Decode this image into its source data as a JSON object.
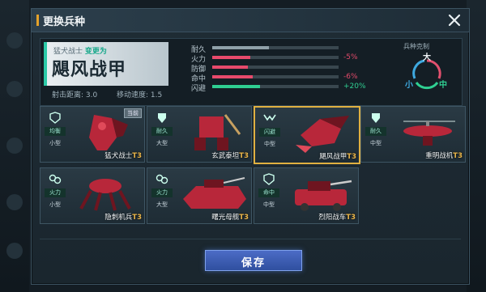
{
  "title": "更换兵种",
  "current_unit": {
    "subtitle_prefix": "猛犬战士",
    "subtitle_change": "变更为",
    "name": "飓风战甲",
    "range_label": "射击距离: 3.0",
    "speed_label": "移动速度: 1.5"
  },
  "stats": [
    {
      "label": "耐久",
      "value": 0.45,
      "color": "#8fa0a8",
      "delta": "",
      "delta_color": "#e24a6a"
    },
    {
      "label": "火力",
      "value": 0.3,
      "color": "#e84a6c",
      "delta": "-5%",
      "delta_color": "#e24a6a"
    },
    {
      "label": "防御",
      "value": 0.28,
      "color": "#e84a6c",
      "delta": "",
      "delta_color": "#e24a6a"
    },
    {
      "label": "命中",
      "value": 0.32,
      "color": "#e84a6c",
      "delta": "-6%",
      "delta_color": "#e24a6a"
    },
    {
      "label": "闪避",
      "value": 0.38,
      "color": "#2fcf92",
      "delta": "+20%",
      "delta_color": "#2fcf92"
    }
  ],
  "counter": {
    "title": "兵种克制",
    "big": "大",
    "small": "小",
    "medium": "中"
  },
  "units": [
    {
      "type": "均衡",
      "size": "小型",
      "name": "猛犬战士",
      "tier": "T3",
      "current_badge": "当前",
      "selected": false
    },
    {
      "type": "耐久",
      "size": "大型",
      "name": "玄武泰坦",
      "tier": "T3",
      "current_badge": "",
      "selected": false
    },
    {
      "type": "闪避",
      "size": "中型",
      "name": "飓风战甲",
      "tier": "T3",
      "current_badge": "",
      "selected": true
    },
    {
      "type": "耐久",
      "size": "中型",
      "name": "重明战机",
      "tier": "T3",
      "current_badge": "",
      "selected": false
    },
    {
      "type": "火力",
      "size": "小型",
      "name": "隐刺机兵",
      "tier": "T3",
      "current_badge": "",
      "selected": false
    },
    {
      "type": "火力",
      "size": "大型",
      "name": "曙光母舰",
      "tier": "T3",
      "current_badge": "",
      "selected": false
    },
    {
      "type": "命中",
      "size": "中型",
      "name": "烈阳战车",
      "tier": "T3",
      "current_badge": "",
      "selected": false
    }
  ],
  "save_label": "保存",
  "colors": {
    "accent": "#e3a22a",
    "selected_border": "#e0b041",
    "save": "#3c5db5"
  }
}
